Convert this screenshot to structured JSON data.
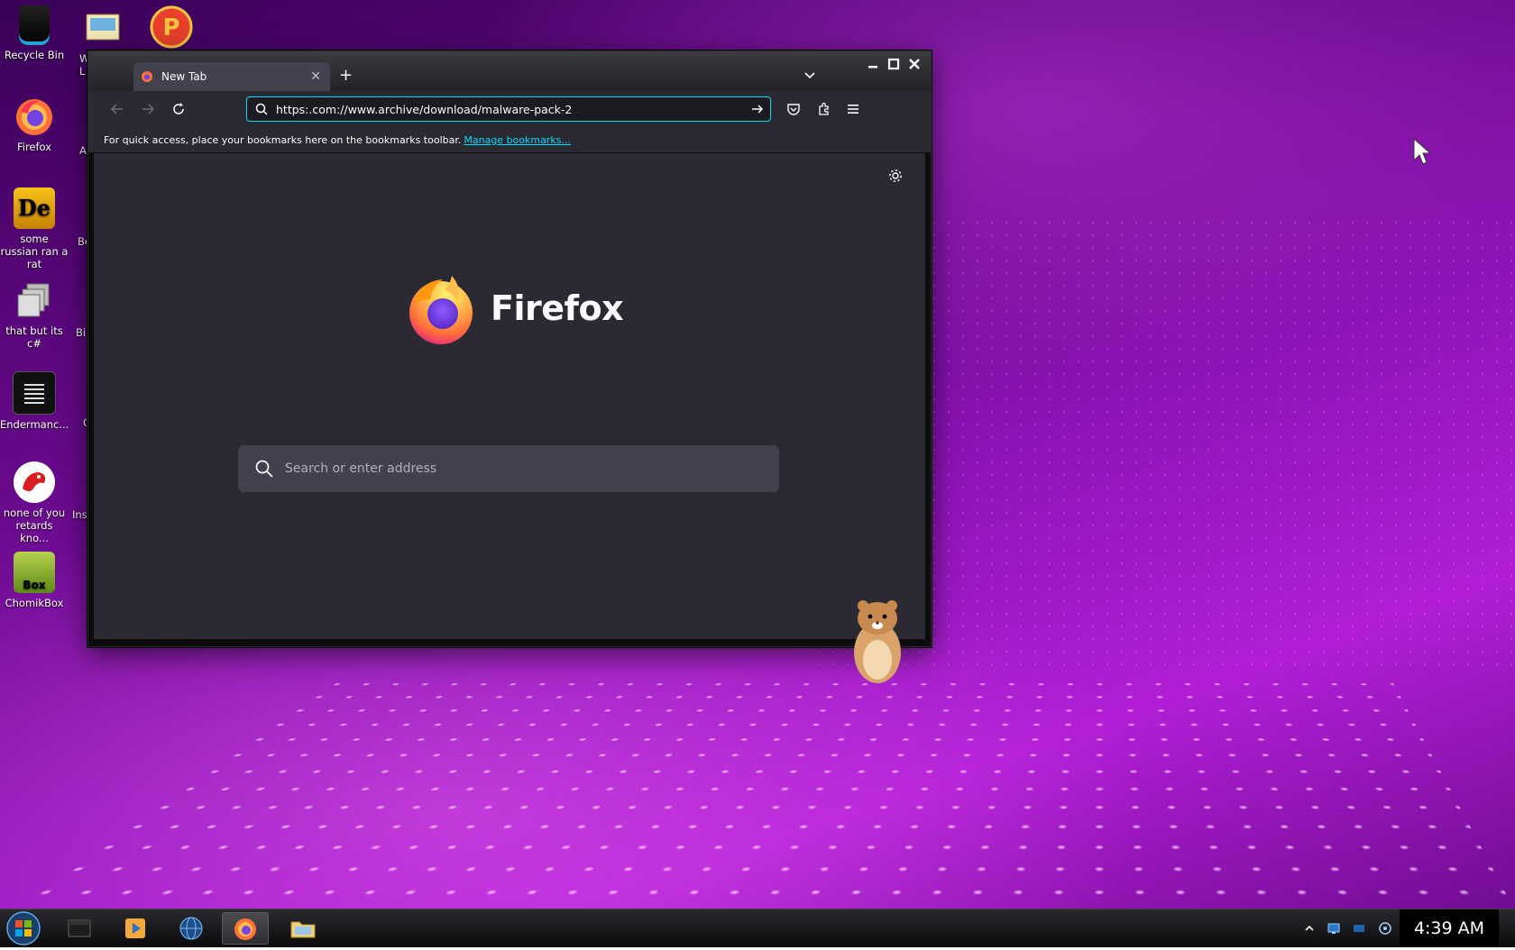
{
  "desktop": {
    "icons": [
      {
        "label": "Recycle Bin"
      },
      {
        "label": "Firefox"
      },
      {
        "label": "some russian ran a rat"
      },
      {
        "label": "that but its c#"
      },
      {
        "label": "Endermanc..."
      },
      {
        "label": "none of you retards kno..."
      },
      {
        "label": "ChomikBox"
      }
    ],
    "partial_labels": [
      "W",
      "L",
      "A",
      "Be",
      "Bi",
      "C",
      "Ins"
    ]
  },
  "browser": {
    "tab_title": "New Tab",
    "url": "https:.com://www.archive/download/malware-pack-2",
    "bookmarks_text": "For quick access, place your bookmarks here on the bookmarks toolbar.",
    "bookmarks_link": "Manage bookmarks...",
    "wordmark": "Firefox",
    "search_placeholder": "Search or enter address"
  },
  "taskbar": {
    "clock": "4:39 AM"
  },
  "colors": {
    "accent": "#00ddff",
    "toolbar": "#2b2a33",
    "content_bg": "#2b2a33"
  }
}
